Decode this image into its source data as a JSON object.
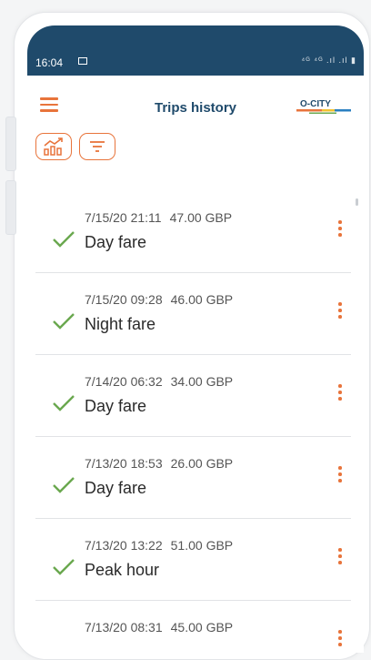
{
  "status_bar": {
    "time": "16:04",
    "signal_text": "⁴ᴳ ⁴ᴳ .ıl .ıl ▮"
  },
  "header": {
    "title": "Trips history",
    "logo_text": "O-CITY"
  },
  "toolbar": {
    "chart_icon": "chart-icon",
    "filter_icon": "filter-icon"
  },
  "trips": [
    {
      "datetime": "7/15/20 21:11",
      "amount": "47.00 GBP",
      "type": "Day fare"
    },
    {
      "datetime": "7/15/20 09:28",
      "amount": "46.00 GBP",
      "type": "Night fare"
    },
    {
      "datetime": "7/14/20 06:32",
      "amount": "34.00 GBP",
      "type": "Day fare"
    },
    {
      "datetime": "7/13/20 18:53",
      "amount": "26.00 GBP",
      "type": "Day fare"
    },
    {
      "datetime": "7/13/20 13:22",
      "amount": "51.00 GBP",
      "type": "Peak hour"
    },
    {
      "datetime": "7/13/20 08:31",
      "amount": "45.00 GBP",
      "type": ""
    }
  ],
  "colors": {
    "accent": "#e8743b",
    "brand": "#1f4a6b",
    "check": "#6aa84f"
  }
}
